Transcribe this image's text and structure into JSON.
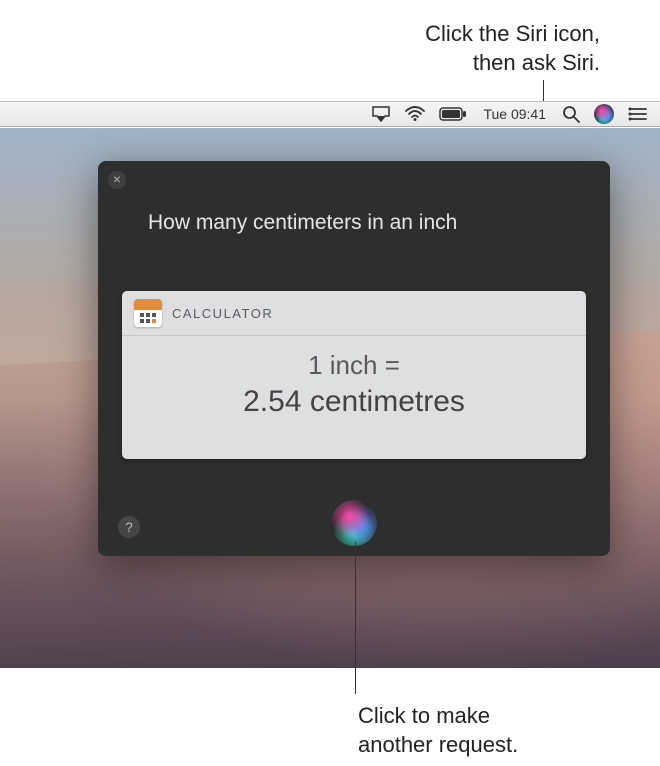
{
  "callouts": {
    "top_line1": "Click the Siri icon,",
    "top_line2": "then ask Siri.",
    "bottom_line1": "Click to make",
    "bottom_line2": "another request."
  },
  "menubar": {
    "time": "Tue 09:41"
  },
  "siri": {
    "query": "How many centimeters in an inch"
  },
  "calculator": {
    "header": "CALCULATOR",
    "line1": "1 inch =",
    "line2": "2.54 centimetres"
  },
  "help": {
    "label": "?"
  }
}
